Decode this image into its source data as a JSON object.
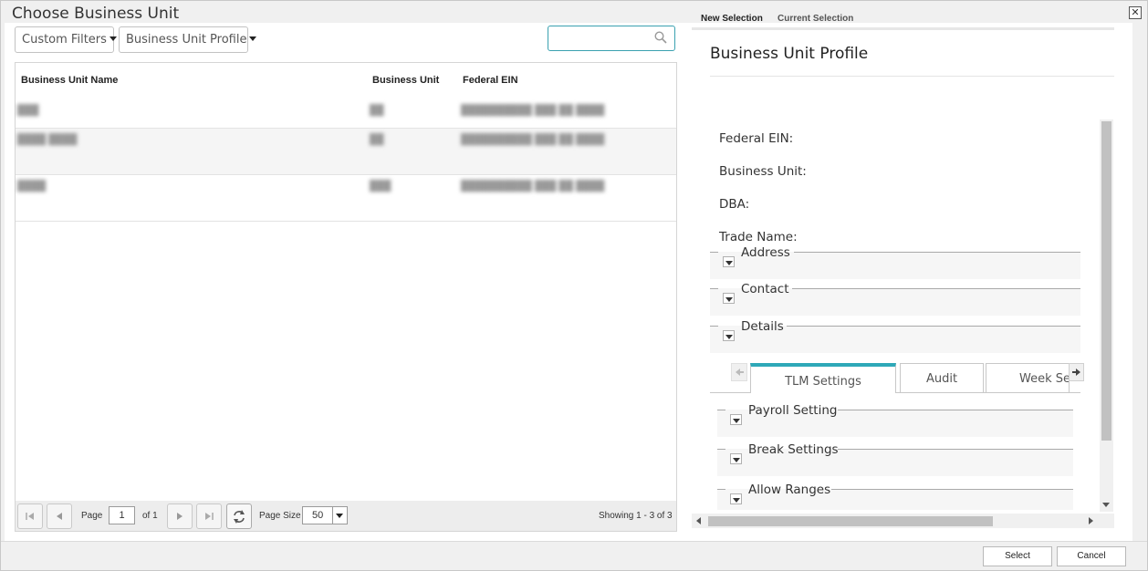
{
  "window": {
    "title": "Choose Business Unit",
    "close_glyph": "✕"
  },
  "toolbar": {
    "custom_filters_label": "Custom Filters",
    "profile_label": "Business Unit Profile",
    "search_placeholder": ""
  },
  "grid": {
    "columns": [
      "Business Unit Name",
      "Business Unit",
      "Federal EIN"
    ],
    "rows": [
      {
        "name": "███",
        "unit": "██",
        "ein": "██████████ ███ ██ ████"
      },
      {
        "name": "████ ████",
        "unit": "██",
        "ein": "██████████ ███ ██ ████"
      },
      {
        "name": "████",
        "unit": "███",
        "ein": "██████████ ███ ██ ████"
      }
    ]
  },
  "pager": {
    "page_label": "Page",
    "page_value": "1",
    "of_label": "of 1",
    "page_size_label": "Page Size",
    "page_size_value": "50",
    "showing": "Showing 1 - 3 of 3"
  },
  "right_panel": {
    "tabs": [
      "New Selection",
      "Current Selection"
    ],
    "profile_title": "Business Unit Profile",
    "fields": [
      "Federal EIN:",
      "Business Unit:",
      "DBA:",
      "Trade Name:"
    ],
    "sections": [
      "Address",
      "Contact",
      "Details"
    ],
    "content_tabs": [
      "TLM Settings",
      "Audit",
      "Week Settings"
    ],
    "tlm_sections": [
      "Payroll Setting",
      "Break Settings",
      "Allow Ranges"
    ]
  },
  "footer": {
    "select_label": "Select",
    "cancel_label": "Cancel"
  },
  "colors": {
    "accent": "#3aa1b0",
    "tab_active": "#2ea8b8"
  }
}
